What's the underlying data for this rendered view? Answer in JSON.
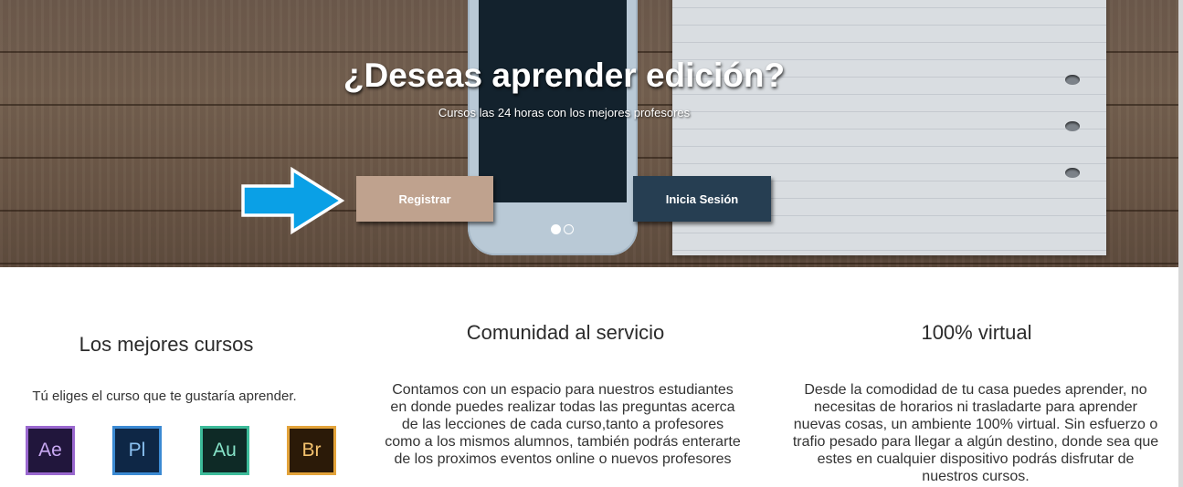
{
  "hero": {
    "title": "¿Deseas aprender edición?",
    "subtitle": "Cursos las 24 horas con los mejores profesores",
    "register_label": "Registrar",
    "login_label": "Inicia Sesión",
    "slides_total": 2,
    "active_slide": 1
  },
  "features": [
    {
      "title": "Los mejores cursos",
      "text": "Tú eliges el curso que te gustaría aprender.",
      "apps": [
        {
          "label": "Ae",
          "icon": "after-effects-icon",
          "color": "#9a68cf"
        },
        {
          "label": "Pl",
          "icon": "prelude-icon",
          "color": "#3b8ad3"
        },
        {
          "label": "Au",
          "icon": "audition-icon",
          "color": "#3dbb9a"
        },
        {
          "label": "Br",
          "icon": "bridge-icon",
          "color": "#e3a33a"
        }
      ]
    },
    {
      "title": "Comunidad al servicio",
      "text": "Contamos con un espacio para nuestros estudiantes en donde puedes realizar todas las preguntas acerca de las lecciones de cada curso,tanto a profesores como a los mismos alumnos, también podrás enterarte de los proximos eventos online o nuevos profesores"
    },
    {
      "title": "100% virtual",
      "text": "Desde la comodidad de tu casa puedes aprender, no necesitas de horarios ni trasladarte para aprender nuevas cosas, un ambiente 100% virtual. Sin esfuerzo o trafio pesado para llegar a algún destino, donde sea que estes en cualquier dispositivo podrás disfrutar de nuestros cursos."
    }
  ],
  "colors": {
    "register_button": "#bfa28e",
    "login_button": "#263e52",
    "annotation_arrow": "#0aa0e6"
  }
}
